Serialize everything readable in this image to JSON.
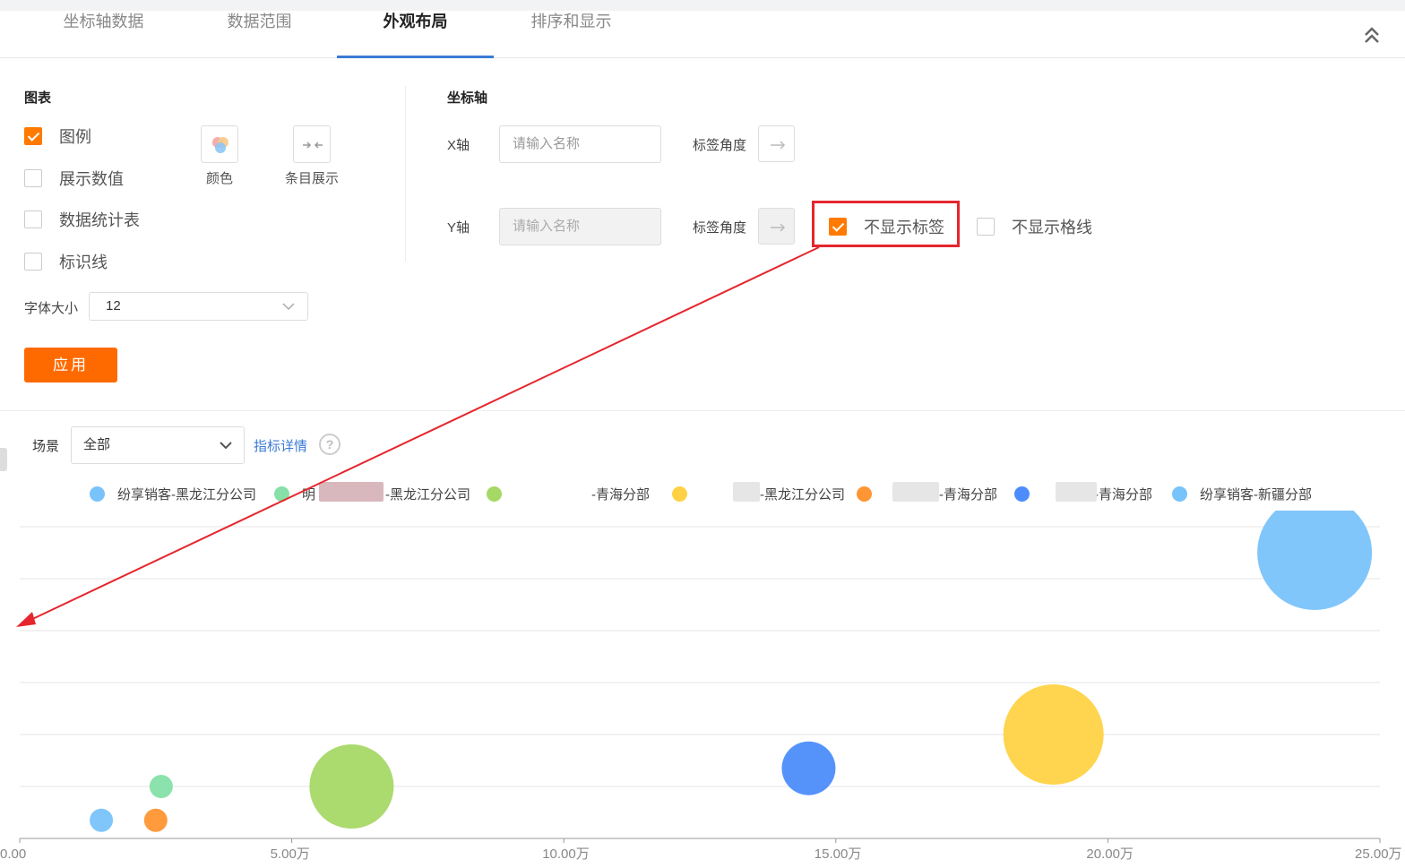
{
  "tabs": [
    {
      "label": "坐标轴数据"
    },
    {
      "label": "数据范围"
    },
    {
      "label": "外观布局"
    },
    {
      "label": "排序和显示"
    }
  ],
  "chart_panel": {
    "title": "图表",
    "options": [
      {
        "label": "图例",
        "checked": true
      },
      {
        "label": "展示数值",
        "checked": false
      },
      {
        "label": "数据统计表",
        "checked": false
      },
      {
        "label": "标识线",
        "checked": false
      }
    ],
    "color_label": "颜色",
    "items_label": "条目展示",
    "font_size_label": "字体大小",
    "font_size_value": "12",
    "apply_label": "应用"
  },
  "axis_panel": {
    "title": "坐标轴",
    "x": {
      "label": "X轴",
      "placeholder": "请输入名称",
      "angle_label": "标签角度"
    },
    "y": {
      "label": "Y轴",
      "placeholder": "请输入名称",
      "angle_label": "标签角度"
    },
    "hide_labels": {
      "label": "不显示标签",
      "checked": true
    },
    "hide_grid": {
      "label": "不显示格线",
      "checked": false
    }
  },
  "scene": {
    "label": "场景",
    "value": "全部",
    "detail_link": "指标详情",
    "help": "?"
  },
  "colors": {
    "accent": "#ff6a00",
    "tab_active": "#3a7bd5",
    "highlight": "#e5262d"
  },
  "chart_data": {
    "type": "scatter",
    "legend": [
      {
        "name": "纷享销客-黑龙江分公司",
        "color": "#79c3fb"
      },
      {
        "name": "明",
        "suffix": "-黑龙江分公司",
        "color": "#86e0a8"
      },
      {
        "name": "",
        "suffix": "-青海分部",
        "color": "#a6d866"
      },
      {
        "name": "",
        "suffix": "-黑龙江分公司",
        "color": "#ffd245"
      },
      {
        "name": "",
        "suffix": "-青海分部",
        "color": "#ff9533"
      },
      {
        "name": "",
        "suffix": "-青海分部",
        "color": "#4c8dfb"
      },
      {
        "name": "纷享销客-新疆分部",
        "color": "#79c3fb"
      }
    ],
    "x_ticks": [
      "0.00",
      "5.00万",
      "10.00万",
      "15.00万",
      "20.00万",
      "25.00万"
    ],
    "xlim": [
      0,
      25
    ],
    "ylim": [
      0,
      6
    ],
    "x_unit": "万",
    "grid": true,
    "show_y_labels": false,
    "points": [
      {
        "series": 0,
        "x": 1.5,
        "y": 0.35,
        "r": 13,
        "color": "#79c3fb"
      },
      {
        "series": 1,
        "x": 2.6,
        "y": 1.0,
        "r": 13,
        "color": "#86e0a8"
      },
      {
        "series": 4,
        "x": 2.5,
        "y": 0.35,
        "r": 13,
        "color": "#ff9533"
      },
      {
        "series": 2,
        "x": 6.1,
        "y": 1.0,
        "r": 47,
        "color": "#a6d866"
      },
      {
        "series": 5,
        "x": 14.5,
        "y": 1.35,
        "r": 30,
        "color": "#4c8dfb"
      },
      {
        "series": 3,
        "x": 19.0,
        "y": 2.0,
        "r": 56,
        "color": "#ffd245"
      },
      {
        "series": 6,
        "x": 23.8,
        "y": 5.5,
        "r": 64,
        "color": "#79c3fb"
      }
    ]
  }
}
